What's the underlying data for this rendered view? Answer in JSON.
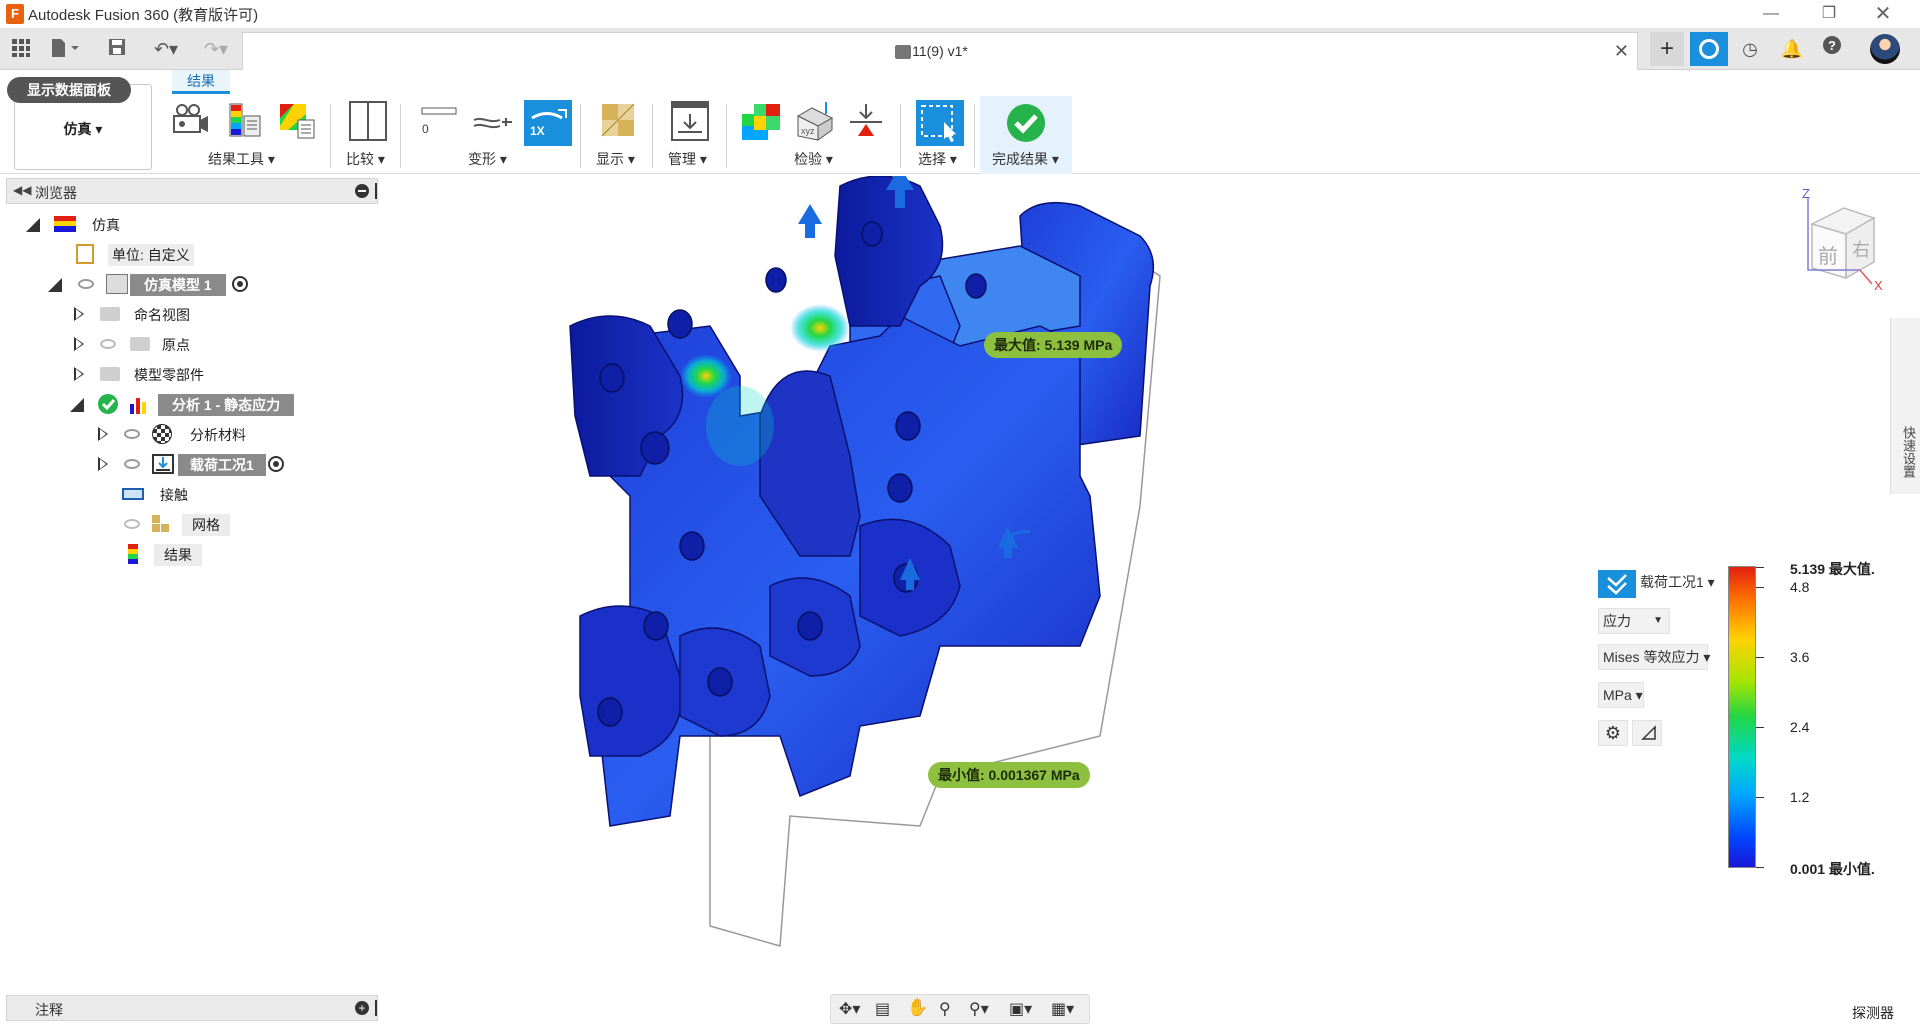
{
  "window": {
    "title": "Autodesk Fusion 360 (教育版许可)",
    "logo_letter": "F"
  },
  "document": {
    "tab_title": "11(9) v1*"
  },
  "toolbar": {
    "dashboard_button": "显示数据面板",
    "workspace": "仿真 ▾",
    "active_tab": "结果",
    "groups": [
      "结果工具 ▾",
      "比较 ▾",
      "变形 ▾",
      "显示 ▾",
      "管理 ▾",
      "检验 ▾",
      "选择 ▾",
      "完成结果 ▾"
    ],
    "deform_value": "0",
    "deform_scale": "1X"
  },
  "browser": {
    "title": "浏览器",
    "items": [
      {
        "label": "仿真"
      },
      {
        "label": "单位: 自定义"
      },
      {
        "label": "仿真模型 1"
      },
      {
        "label": "命名视图"
      },
      {
        "label": "原点"
      },
      {
        "label": "模型零部件"
      },
      {
        "label": "分析 1 - 静态应力"
      },
      {
        "label": "分析材料"
      },
      {
        "label": "载荷工况1"
      },
      {
        "label": "接触"
      },
      {
        "label": "网格"
      },
      {
        "label": "结果"
      }
    ]
  },
  "notes": {
    "label": "注释"
  },
  "viewport": {
    "max_callout": "最大值: 5.139 MPa",
    "min_callout": "最小值: 0.001367 MPa",
    "viewcube_front": "前",
    "viewcube_right": "右",
    "axis_z": "Z",
    "axis_x": "X"
  },
  "quick_settings": {
    "label": "快速设置"
  },
  "legend": {
    "load_case": "载荷工况1 ▾",
    "result_type": "应力",
    "stress_type": "Mises 等效应力 ▾",
    "unit": "MPa ▾",
    "max_label": "5.139 最大值.",
    "min_label": "0.001 最小值.",
    "ticks": [
      "4.8",
      "3.6",
      "2.4",
      "1.2"
    ],
    "colors": [
      "#e32010",
      "#ffd200",
      "#21d646",
      "#00d9c9",
      "#0046ff"
    ]
  },
  "inspector": {
    "label": "探测器"
  }
}
